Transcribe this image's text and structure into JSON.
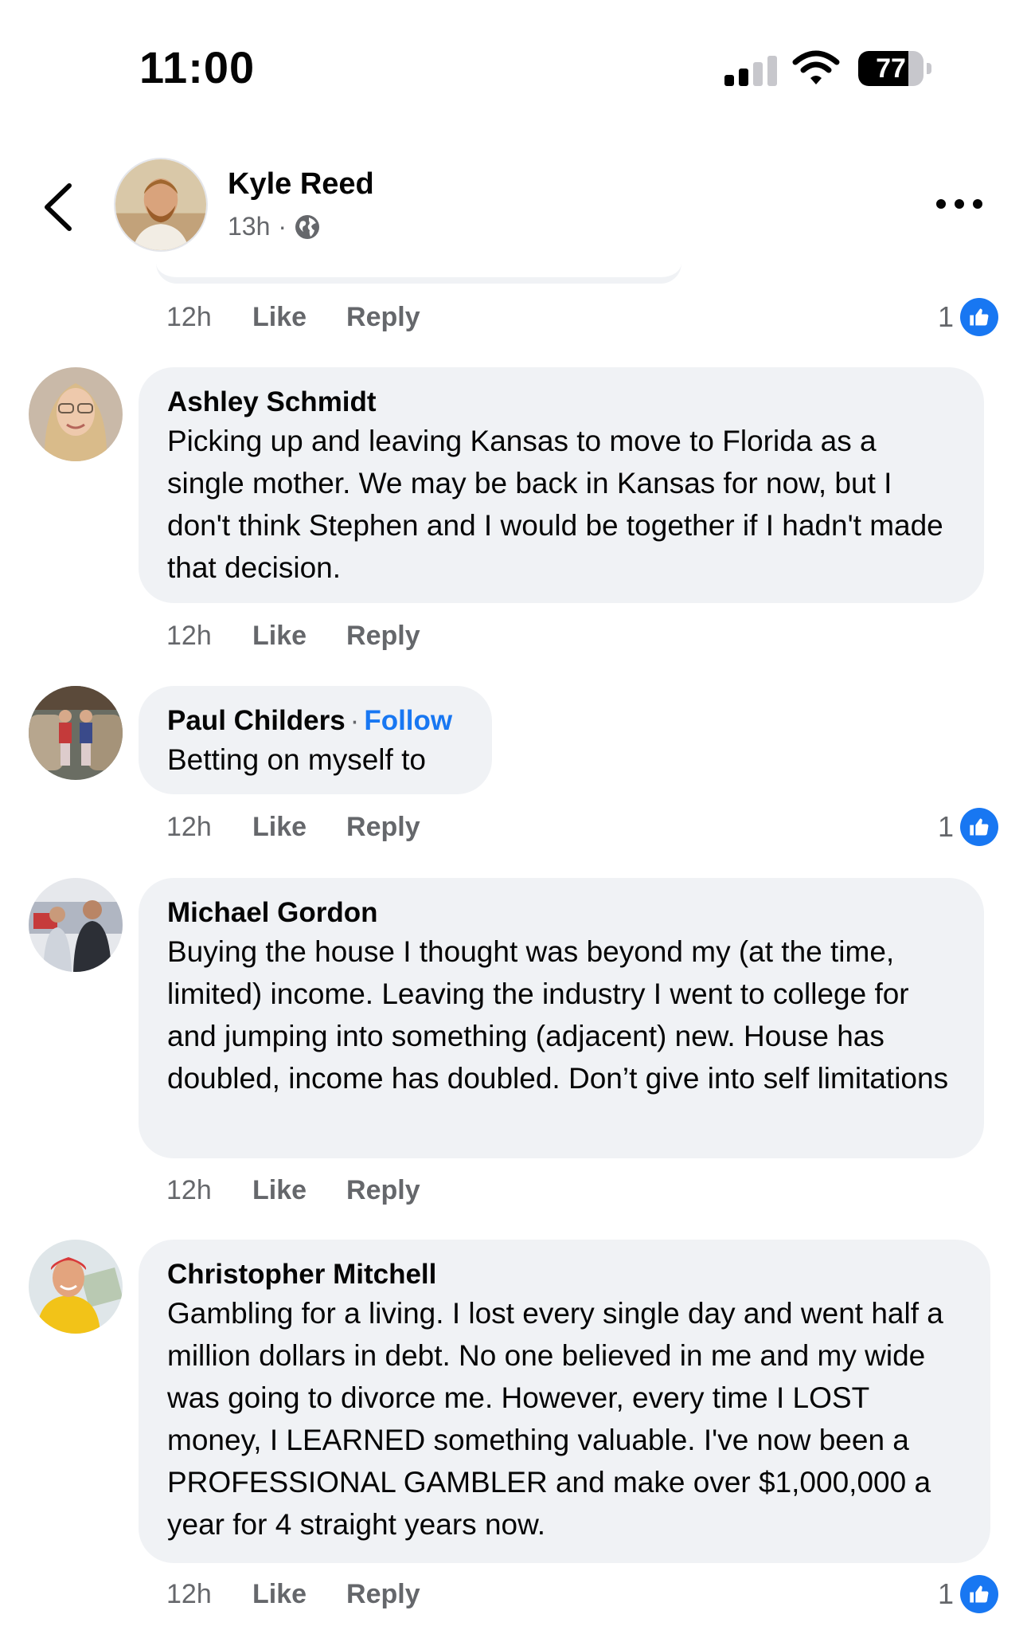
{
  "status_bar": {
    "time": "11:00",
    "battery": "77"
  },
  "post_header": {
    "author": "Kyle Reed",
    "time": "13h",
    "separator": "·"
  },
  "top_row": {
    "time": "12h",
    "like": "Like",
    "reply": "Reply",
    "reaction_count": "1"
  },
  "comments": [
    {
      "author": "Ashley Schmidt",
      "text": "Picking up and leaving Kansas to move to Florida as a single mother. We may be back in Kansas for now, but I don't think Stephen and I would be together if I hadn't made that decision.",
      "time": "12h",
      "like": "Like",
      "reply": "Reply"
    },
    {
      "author": "Paul Childers",
      "separator": "·",
      "follow": "Follow",
      "text": "Betting on myself to",
      "time": "12h",
      "like": "Like",
      "reply": "Reply",
      "reaction_count": "1"
    },
    {
      "author": "Michael Gordon",
      "text": "Buying the house I thought was beyond my (at the time, limited) income. Leaving the industry I went to college for and jumping into something (adjacent) new. House has doubled, income has doubled. Don’t give into self limitations",
      "time": "12h",
      "like": "Like",
      "reply": "Reply"
    },
    {
      "author": "Christopher Mitchell",
      "text": "Gambling for a living. I lost every single day and went half a million dollars in debt. No one believed in me and my wide was going to divorce me. However, every time I LOST money, I LEARNED something valuable. I've now been a PROFESSIONAL GAMBLER and make over $1,000,000 a year for 4 straight years now.",
      "time": "12h",
      "like": "Like",
      "reply": "Reply",
      "reaction_count": "1"
    }
  ],
  "colors": {
    "accent": "#1877f2",
    "bubble": "#f0f2f5",
    "muted": "#65676b"
  }
}
